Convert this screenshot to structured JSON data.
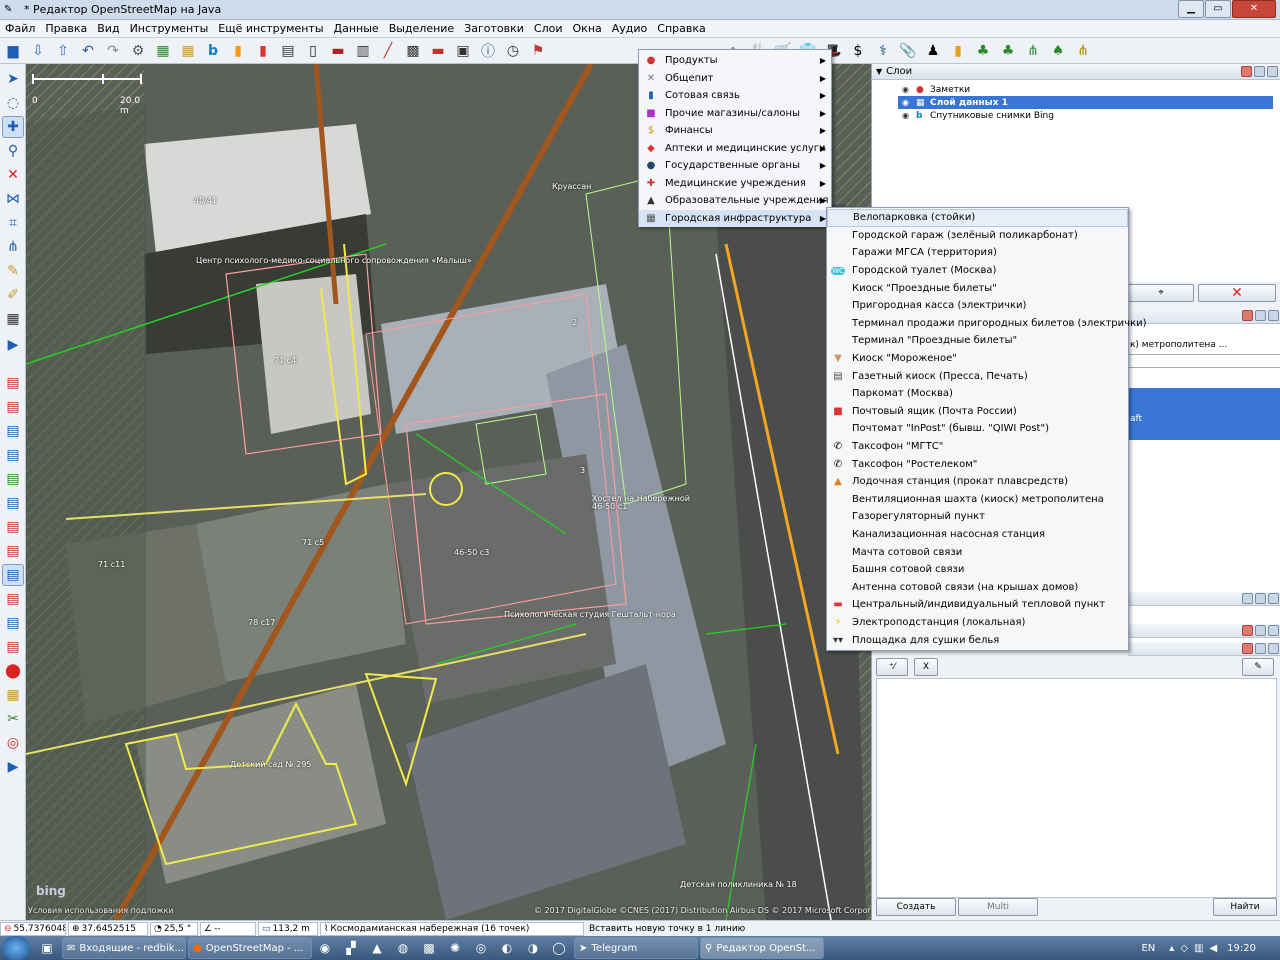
{
  "window": {
    "title": "* Редактор OpenStreetMap на Java",
    "app_icon": "josm-icon",
    "buttons": [
      "minimize",
      "maximize",
      "close"
    ]
  },
  "menubar": {
    "items": [
      "Файл",
      "Правка",
      "Вид",
      "Инструменты",
      "Ещё инструменты",
      "Данные",
      "Выделение",
      "Заготовки",
      "Слои",
      "Окна",
      "Аудио",
      "Справка"
    ]
  },
  "map": {
    "scale": {
      "start": "0",
      "end": "20.0 m"
    },
    "labels": [
      "40/41",
      "Круассан",
      "Центр психолого-медико-социального сопровождения «Малыш»",
      "71 с4",
      "2",
      "71 с5",
      "71 с11",
      "78 с17",
      "3",
      "Хостел на Набережной",
      "46-50 с1",
      "46-50 с3",
      "Психологическая студия Гештальт-нора",
      "Детский сад № 295",
      "Детская поликлиника № 18"
    ],
    "bing_logo": "bing",
    "terms": "Условия использования подложки",
    "copyright": "© 2017 DigitalGlobe ©CNES (2017) Distribution Airbus DS © 2017 Microsoft Corporation"
  },
  "presets_menu": {
    "items": [
      {
        "label": "Продукты",
        "icon": "food-icon"
      },
      {
        "label": "Общепит",
        "icon": "cutlery-icon"
      },
      {
        "label": "Сотовая связь",
        "icon": "phone-icon"
      },
      {
        "label": "Прочие магазины/салоны",
        "icon": "shop-icon"
      },
      {
        "label": "Финансы",
        "icon": "money-icon"
      },
      {
        "label": "Аптеки и медицинские услуги",
        "icon": "pharmacy-icon"
      },
      {
        "label": "Государственные органы",
        "icon": "government-icon"
      },
      {
        "label": "Медицинские учреждения",
        "icon": "medical-icon"
      },
      {
        "label": "Образовательные учреждения",
        "icon": "school-icon"
      },
      {
        "label": "Городская инфраструктура",
        "icon": "infrastructure-icon"
      }
    ]
  },
  "submenu": {
    "items": [
      {
        "label": "Велопарковка (стойки)",
        "icon": ""
      },
      {
        "label": "Городской гараж (зелёный поликарбонат)",
        "icon": ""
      },
      {
        "label": "Гаражи МГСА (территория)",
        "icon": ""
      },
      {
        "label": "Городской туалет (Москва)",
        "icon": "toilet-icon"
      },
      {
        "label": "Киоск \"Проездные билеты\"",
        "icon": ""
      },
      {
        "label": "Пригородная касса (электрички)",
        "icon": ""
      },
      {
        "label": "Терминал продажи пригородных билетов (электрички)",
        "icon": ""
      },
      {
        "label": "Терминал \"Проездные билеты\"",
        "icon": ""
      },
      {
        "label": "Киоск \"Мороженое\"",
        "icon": "icecream-icon"
      },
      {
        "label": "Газетный киоск (Пресса, Печать)",
        "icon": "newspaper-icon"
      },
      {
        "label": "Паркомат (Москва)",
        "icon": ""
      },
      {
        "label": "Почтовый ящик (Почта России)",
        "icon": "mailbox-icon"
      },
      {
        "label": "Почтомат \"InPost\" (бывш. \"QIWI Post\")",
        "icon": ""
      },
      {
        "label": "Таксофон \"МГТС\"",
        "icon": "telephone-icon"
      },
      {
        "label": "Таксофон \"Ростелеком\"",
        "icon": "telephone-icon"
      },
      {
        "label": "Лодочная станция (прокат плавсредств)",
        "icon": "boat-icon"
      },
      {
        "label": "Вентиляционная шахта (киоск) метрополитена",
        "icon": ""
      },
      {
        "label": "Газорегуляторный пункт",
        "icon": ""
      },
      {
        "label": "Канализационная насосная станция",
        "icon": ""
      },
      {
        "label": "Мачта сотовой связи",
        "icon": ""
      },
      {
        "label": "Башня сотовой связи",
        "icon": ""
      },
      {
        "label": "Антенна сотовой связи (на крышах домов)",
        "icon": ""
      },
      {
        "label": "Центральный/индивидуальный тепловой пункт",
        "icon": "heating-icon"
      },
      {
        "label": "Электроподстанция (локальная)",
        "icon": "power-icon"
      },
      {
        "label": "Площадка для сушки белья",
        "icon": "laundry-icon"
      }
    ]
  },
  "layers_panel": {
    "title": "Слои",
    "layers": [
      {
        "label": "Заметки",
        "selected": false,
        "icon": "notes-icon"
      },
      {
        "label": "Слой данных 1",
        "selected": true,
        "icon": "data-layer-icon"
      },
      {
        "label": "Спутниковые снимки Bing",
        "icon": "bing-icon",
        "selected": false
      }
    ]
  },
  "tags_panel": {
    "partial_text": "к) метрополитена ...",
    "partial_text2": "aft"
  },
  "relation_panel": {
    "create_label": "Создать",
    "multi_label": "Multi",
    "find_label": "Найти"
  },
  "statusbar": {
    "lat": "55.7376048",
    "lon": "37.6452515",
    "angle": "25,5 °",
    "heading": "--",
    "distance": "113,2 m",
    "way": "Космодамианская набережная (16 точек)",
    "hint": "Вставить новую точку в 1 линию"
  },
  "taskbar": {
    "apps": [
      "Входящие - redbik...",
      "OpenStreetMap - ...",
      "Telegram",
      "Редактор OpenSt..."
    ],
    "lang": "EN",
    "time": "19:20"
  },
  "colors": {
    "selected_layer": "#3875d7",
    "menu_hover": "#d6e3f4",
    "road_orange": "#f5a623",
    "building_outline": "#ff9d9d",
    "yellow_area": "#f3f00a",
    "green_line": "#22d420"
  }
}
